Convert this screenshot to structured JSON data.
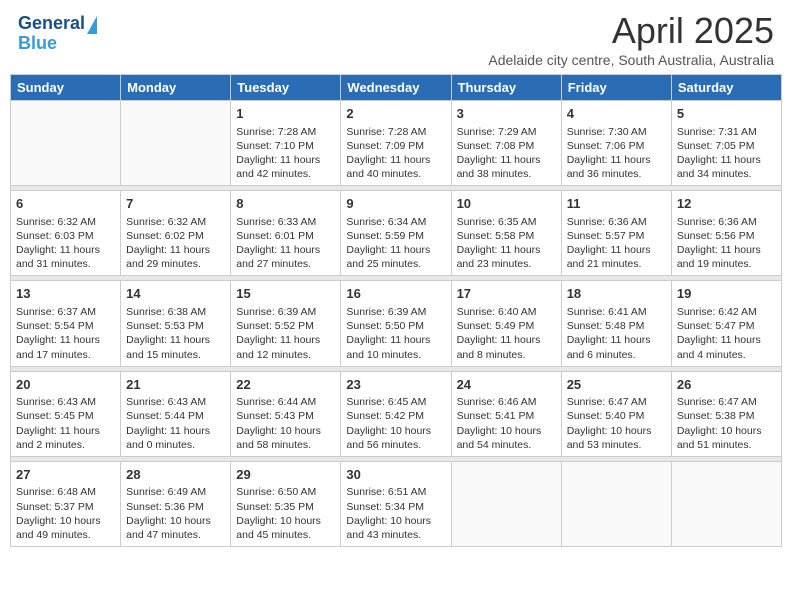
{
  "header": {
    "logo_line1": "General",
    "logo_line2": "Blue",
    "month_title": "April 2025",
    "subtitle": "Adelaide city centre, South Australia, Australia"
  },
  "days_of_week": [
    "Sunday",
    "Monday",
    "Tuesday",
    "Wednesday",
    "Thursday",
    "Friday",
    "Saturday"
  ],
  "weeks": [
    [
      {
        "day": "",
        "sunrise": "",
        "sunset": "",
        "daylight": ""
      },
      {
        "day": "",
        "sunrise": "",
        "sunset": "",
        "daylight": ""
      },
      {
        "day": "1",
        "sunrise": "Sunrise: 7:28 AM",
        "sunset": "Sunset: 7:10 PM",
        "daylight": "Daylight: 11 hours and 42 minutes."
      },
      {
        "day": "2",
        "sunrise": "Sunrise: 7:28 AM",
        "sunset": "Sunset: 7:09 PM",
        "daylight": "Daylight: 11 hours and 40 minutes."
      },
      {
        "day": "3",
        "sunrise": "Sunrise: 7:29 AM",
        "sunset": "Sunset: 7:08 PM",
        "daylight": "Daylight: 11 hours and 38 minutes."
      },
      {
        "day": "4",
        "sunrise": "Sunrise: 7:30 AM",
        "sunset": "Sunset: 7:06 PM",
        "daylight": "Daylight: 11 hours and 36 minutes."
      },
      {
        "day": "5",
        "sunrise": "Sunrise: 7:31 AM",
        "sunset": "Sunset: 7:05 PM",
        "daylight": "Daylight: 11 hours and 34 minutes."
      }
    ],
    [
      {
        "day": "6",
        "sunrise": "Sunrise: 6:32 AM",
        "sunset": "Sunset: 6:03 PM",
        "daylight": "Daylight: 11 hours and 31 minutes."
      },
      {
        "day": "7",
        "sunrise": "Sunrise: 6:32 AM",
        "sunset": "Sunset: 6:02 PM",
        "daylight": "Daylight: 11 hours and 29 minutes."
      },
      {
        "day": "8",
        "sunrise": "Sunrise: 6:33 AM",
        "sunset": "Sunset: 6:01 PM",
        "daylight": "Daylight: 11 hours and 27 minutes."
      },
      {
        "day": "9",
        "sunrise": "Sunrise: 6:34 AM",
        "sunset": "Sunset: 5:59 PM",
        "daylight": "Daylight: 11 hours and 25 minutes."
      },
      {
        "day": "10",
        "sunrise": "Sunrise: 6:35 AM",
        "sunset": "Sunset: 5:58 PM",
        "daylight": "Daylight: 11 hours and 23 minutes."
      },
      {
        "day": "11",
        "sunrise": "Sunrise: 6:36 AM",
        "sunset": "Sunset: 5:57 PM",
        "daylight": "Daylight: 11 hours and 21 minutes."
      },
      {
        "day": "12",
        "sunrise": "Sunrise: 6:36 AM",
        "sunset": "Sunset: 5:56 PM",
        "daylight": "Daylight: 11 hours and 19 minutes."
      }
    ],
    [
      {
        "day": "13",
        "sunrise": "Sunrise: 6:37 AM",
        "sunset": "Sunset: 5:54 PM",
        "daylight": "Daylight: 11 hours and 17 minutes."
      },
      {
        "day": "14",
        "sunrise": "Sunrise: 6:38 AM",
        "sunset": "Sunset: 5:53 PM",
        "daylight": "Daylight: 11 hours and 15 minutes."
      },
      {
        "day": "15",
        "sunrise": "Sunrise: 6:39 AM",
        "sunset": "Sunset: 5:52 PM",
        "daylight": "Daylight: 11 hours and 12 minutes."
      },
      {
        "day": "16",
        "sunrise": "Sunrise: 6:39 AM",
        "sunset": "Sunset: 5:50 PM",
        "daylight": "Daylight: 11 hours and 10 minutes."
      },
      {
        "day": "17",
        "sunrise": "Sunrise: 6:40 AM",
        "sunset": "Sunset: 5:49 PM",
        "daylight": "Daylight: 11 hours and 8 minutes."
      },
      {
        "day": "18",
        "sunrise": "Sunrise: 6:41 AM",
        "sunset": "Sunset: 5:48 PM",
        "daylight": "Daylight: 11 hours and 6 minutes."
      },
      {
        "day": "19",
        "sunrise": "Sunrise: 6:42 AM",
        "sunset": "Sunset: 5:47 PM",
        "daylight": "Daylight: 11 hours and 4 minutes."
      }
    ],
    [
      {
        "day": "20",
        "sunrise": "Sunrise: 6:43 AM",
        "sunset": "Sunset: 5:45 PM",
        "daylight": "Daylight: 11 hours and 2 minutes."
      },
      {
        "day": "21",
        "sunrise": "Sunrise: 6:43 AM",
        "sunset": "Sunset: 5:44 PM",
        "daylight": "Daylight: 11 hours and 0 minutes."
      },
      {
        "day": "22",
        "sunrise": "Sunrise: 6:44 AM",
        "sunset": "Sunset: 5:43 PM",
        "daylight": "Daylight: 10 hours and 58 minutes."
      },
      {
        "day": "23",
        "sunrise": "Sunrise: 6:45 AM",
        "sunset": "Sunset: 5:42 PM",
        "daylight": "Daylight: 10 hours and 56 minutes."
      },
      {
        "day": "24",
        "sunrise": "Sunrise: 6:46 AM",
        "sunset": "Sunset: 5:41 PM",
        "daylight": "Daylight: 10 hours and 54 minutes."
      },
      {
        "day": "25",
        "sunrise": "Sunrise: 6:47 AM",
        "sunset": "Sunset: 5:40 PM",
        "daylight": "Daylight: 10 hours and 53 minutes."
      },
      {
        "day": "26",
        "sunrise": "Sunrise: 6:47 AM",
        "sunset": "Sunset: 5:38 PM",
        "daylight": "Daylight: 10 hours and 51 minutes."
      }
    ],
    [
      {
        "day": "27",
        "sunrise": "Sunrise: 6:48 AM",
        "sunset": "Sunset: 5:37 PM",
        "daylight": "Daylight: 10 hours and 49 minutes."
      },
      {
        "day": "28",
        "sunrise": "Sunrise: 6:49 AM",
        "sunset": "Sunset: 5:36 PM",
        "daylight": "Daylight: 10 hours and 47 minutes."
      },
      {
        "day": "29",
        "sunrise": "Sunrise: 6:50 AM",
        "sunset": "Sunset: 5:35 PM",
        "daylight": "Daylight: 10 hours and 45 minutes."
      },
      {
        "day": "30",
        "sunrise": "Sunrise: 6:51 AM",
        "sunset": "Sunset: 5:34 PM",
        "daylight": "Daylight: 10 hours and 43 minutes."
      },
      {
        "day": "",
        "sunrise": "",
        "sunset": "",
        "daylight": ""
      },
      {
        "day": "",
        "sunrise": "",
        "sunset": "",
        "daylight": ""
      },
      {
        "day": "",
        "sunrise": "",
        "sunset": "",
        "daylight": ""
      }
    ]
  ]
}
